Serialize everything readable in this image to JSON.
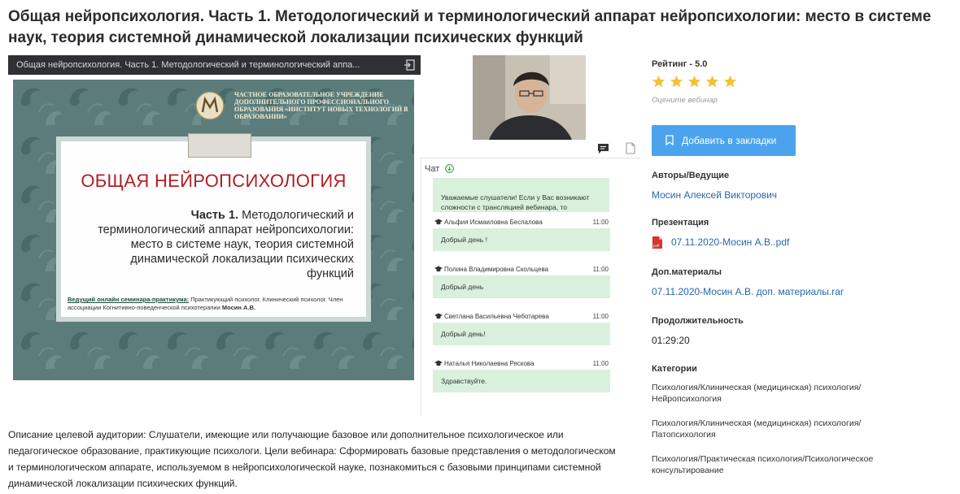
{
  "page": {
    "title": "Общая нейропсихология. Часть 1. Методологический и терминологический аппарат нейропсихологии: место в системе наук, теория системной динамической локализации психических функций"
  },
  "player": {
    "bar_title": "Общая нейропсихология. Часть 1. Методологический и терминологический аппа...",
    "slide": {
      "header_text": "ЧАСТНОЕ ОБРАЗОВАТЕЛЬНОЕ УЧРЕЖДЕНИЕ ДОПОЛНИТЕЛЬНОГО ПРОФЕССИОНАЛЬНОГО ОБРАЗОВАНИЯ «ИНСТИТУТ НОВЫХ ТЕХНОЛОГИЙ В ОБРАЗОВАНИИ»",
      "title": "ОБЩАЯ НЕЙРОПСИХОЛОГИЯ",
      "subtitle_bold": "Часть 1.",
      "subtitle_rest": " Методологический и терминологический аппарат нейропсихологии: место в системе наук, теория системной динамической локализации психических функций",
      "footer_label": "Ведущий онлайн семинара-практикума:",
      "footer_text": " Практикующий психолог. Клинический психолог. Член ассоциации Когнитивно-поведенческой психотерапии ",
      "footer_name": "Мосин А.В."
    }
  },
  "chat": {
    "label": "Чат",
    "notice": "Уважаемые слушатели! Если у Вас возникают сложности с трансляцией вебинара, то",
    "messages": [
      {
        "author": "Альфия Исмаиловна Беспалова",
        "time": "11:00",
        "text": "Добрый день !"
      },
      {
        "author": "Полина Владимировна Скольцева",
        "time": "11:00",
        "text": "Добрый день"
      },
      {
        "author": "Светлана Васильевна Чеботарева",
        "time": "11:00",
        "text": "Добрый день!"
      },
      {
        "author": "Наталья Николаевна Ряскова",
        "time": "11:00",
        "text": "Здравствуйте."
      }
    ]
  },
  "side": {
    "rating_label": "Рейтинг - 5.0",
    "rating_value": 5,
    "rating_max": 5,
    "rate_hint": "Оцените вебинар",
    "bookmark_label": "Добавить в закладки",
    "authors_label": "Авторы/Ведущие",
    "author_name": "Мосин Алексей Викторович",
    "presentation_label": "Презентация",
    "presentation_file": "07.11.2020-Мосин А.В..pdf",
    "materials_label": "Доп.материалы",
    "materials_file": "07.11.2020-Мосин А.В. доп. материалы.rar",
    "duration_label": "Продолжительность",
    "duration": "01:29:20",
    "categories_label": "Категории",
    "categories": [
      "Психология/Клиническая (медицинская) психология/Нейропсихология",
      "Психология/Клиническая (медицинская) психология/Патопсихология",
      "Психология/Практическая психология/Психологическое консультирование"
    ]
  },
  "description": "Описание целевой аудитории: Слушатели, имеющие или получающие базовое или дополнительное психологическое или педагогическое образование, практикующие психологи. Цели вебинара: Сформировать базовые представления о методологическом и терминологическом аппарате, используемом в нейропсихологической науке, познакомиться с базовыми принципами системной динамической локализации психических функций.",
  "colors": {
    "accent": "#4ba3ee",
    "link": "#2765b0",
    "star": "#f1c232",
    "chat_bubble": "#d9f0dd",
    "slide_bg": "#5a7a7a",
    "slide_title": "#b01e24"
  }
}
